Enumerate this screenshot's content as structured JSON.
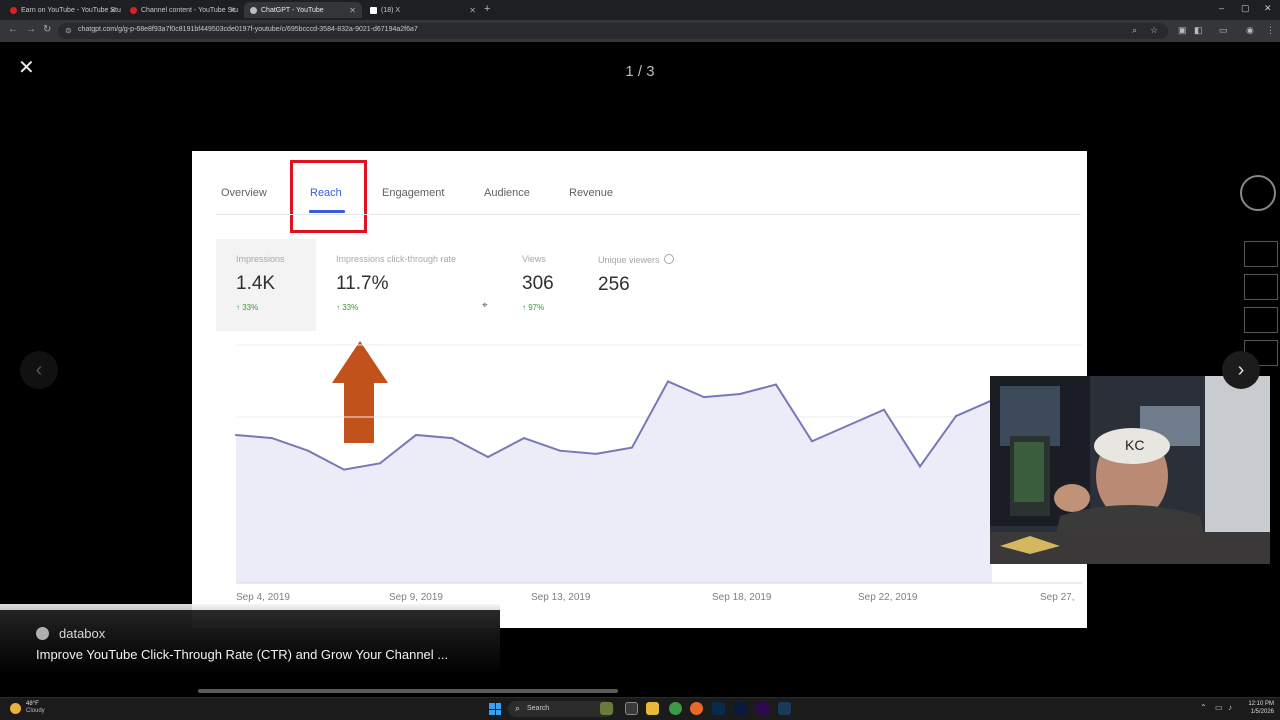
{
  "browser": {
    "tabs": [
      {
        "title": "Earn on YouTube - YouTube Stu",
        "fav_color": "#e02020",
        "active": false
      },
      {
        "title": "Channel content - YouTube Stu",
        "fav_color": "#e02020",
        "active": false
      },
      {
        "title": "ChatGPT - YouTube",
        "fav_color": "#bdbdbd",
        "active": true
      },
      {
        "title": "(18) X",
        "fav_color": "#ffffff",
        "active": false
      }
    ],
    "url": "chatgpt.com/g/g-p-68e8f93a7f0c8191bf449503cde0197f-youtube/c/695bcccd-3584-832a-9021-d67194a2f6a7"
  },
  "viewer": {
    "close_glyph": "✕",
    "counter": "1 / 3",
    "prev_glyph": "‹",
    "next_glyph": "›"
  },
  "slide": {
    "tabs": [
      "Overview",
      "Reach",
      "Engagement",
      "Audience",
      "Revenue"
    ],
    "active_tab": "Reach",
    "metrics": [
      {
        "label": "Impressions",
        "value": "1.4K",
        "change": "↑ 33%"
      },
      {
        "label": "Impressions click-through rate",
        "value": "11.7%",
        "change": "↑ 33%"
      },
      {
        "label": "Views",
        "value": "306",
        "change": "↑ 97%"
      },
      {
        "label": "Unique viewers",
        "value": "256",
        "change": ""
      }
    ],
    "x_labels": [
      "Sep 4, 2019",
      "Sep 9, 2019",
      "Sep 13, 2019",
      "Sep 18, 2019",
      "Sep 22, 2019",
      "Sep 27,"
    ],
    "colors": {
      "accent": "#3b5bdb",
      "highlight_box": "#e01020",
      "arrow": "#c2521c",
      "line": "#7878b8",
      "fill": "#ececf8"
    }
  },
  "chart_data": {
    "type": "area",
    "x": [
      "Sep 4",
      "Sep 5",
      "Sep 6",
      "Sep 7",
      "Sep 8",
      "Sep 9",
      "Sep 10",
      "Sep 11",
      "Sep 12",
      "Sep 13",
      "Sep 14",
      "Sep 15",
      "Sep 16",
      "Sep 17",
      "Sep 18",
      "Sep 19",
      "Sep 20",
      "Sep 21",
      "Sep 22",
      "Sep 23",
      "Sep 24",
      "Sep 25"
    ],
    "series": [
      {
        "values": [
          47,
          46,
          42,
          36,
          38,
          47,
          46,
          40,
          46,
          42,
          41,
          43,
          64,
          59,
          60,
          63,
          45,
          50,
          55,
          37,
          53,
          58
        ]
      }
    ],
    "xlabels": [
      "Sep 4, 2019",
      "Sep 9, 2019",
      "Sep 13, 2019",
      "Sep 18, 2019",
      "Sep 22, 2019",
      "Sep 27,"
    ],
    "ylim": [
      0,
      80
    ],
    "grid": true
  },
  "caption": {
    "source": "databox",
    "title": "Improve YouTube Click-Through Rate (CTR) and Grow Your Channel ..."
  },
  "taskbar": {
    "weather_temp": "48°F",
    "weather_desc": "Cloudy",
    "search": "Search",
    "time": "12:10 PM",
    "date": "1/5/2026"
  }
}
